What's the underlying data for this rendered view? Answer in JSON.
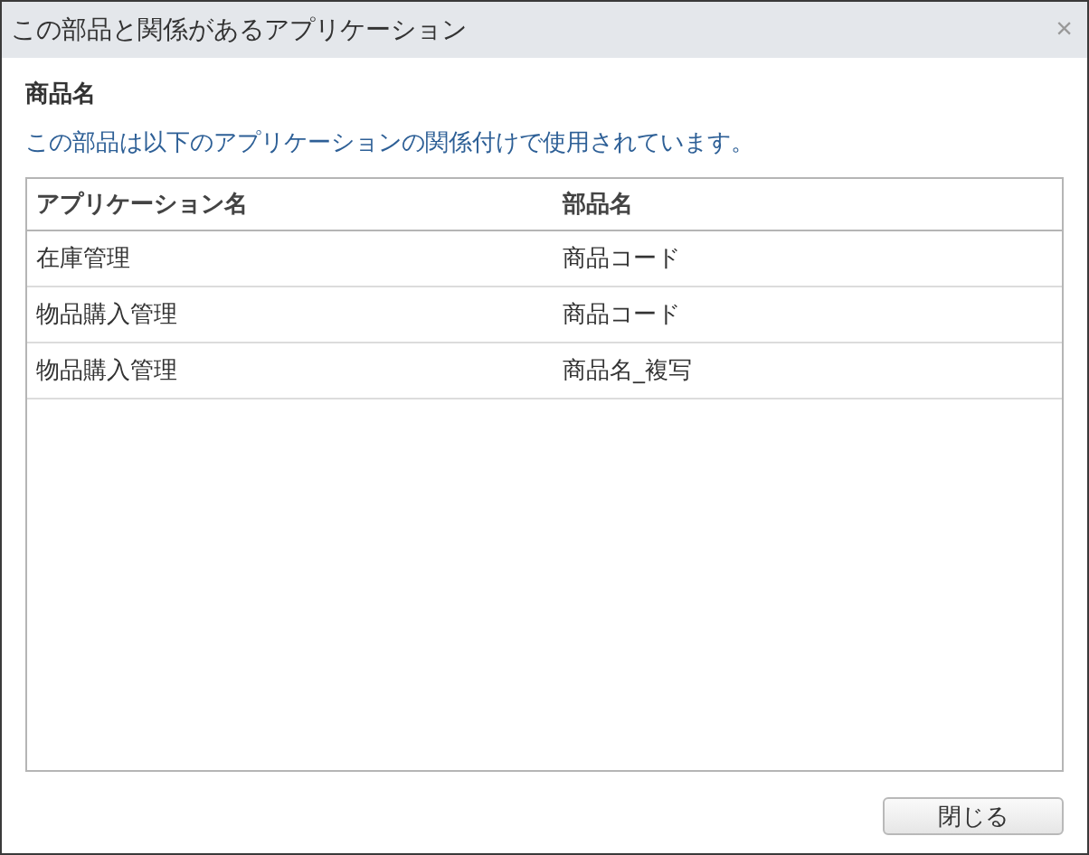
{
  "window": {
    "title": "この部品と関係があるアプリケーション",
    "close": "×"
  },
  "part_name": "商品名",
  "description": "この部品は以下のアプリケーションの関係付けで使用されています。",
  "table": {
    "columns": [
      "アプリケーション名",
      "部品名"
    ],
    "rows": [
      {
        "cells": [
          "在庫管理",
          "商品コード"
        ]
      },
      {
        "cells": [
          "物品購入管理",
          "商品コード"
        ]
      },
      {
        "cells": [
          "物品購入管理",
          "商品名_複写"
        ]
      }
    ]
  },
  "buttons": [
    "閉じる"
  ]
}
